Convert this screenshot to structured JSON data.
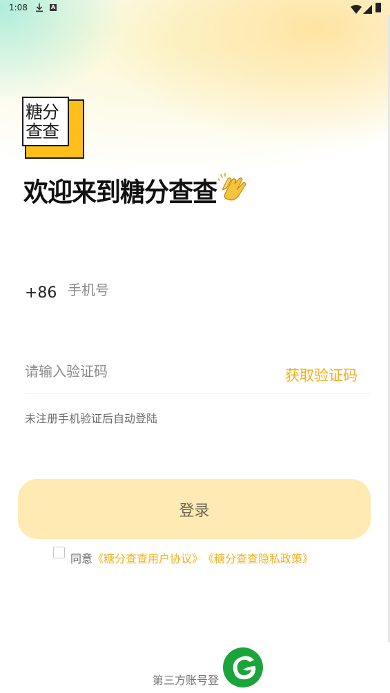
{
  "status_bar": {
    "time": "1:08",
    "icons": [
      "download-icon",
      "accessibility-a-icon",
      "wifi-icon",
      "signal-icon",
      "battery-icon"
    ]
  },
  "logo": {
    "line1": "糖分",
    "line2": "查查",
    "colors": {
      "shadow": "#ffbf1a",
      "face": "#ffffff",
      "outline": "#1a1a1a"
    }
  },
  "welcome": {
    "title": "欢迎来到糖分查查",
    "icon": "clapping-hands-icon"
  },
  "phone": {
    "country_code": "+86",
    "placeholder": "手机号"
  },
  "verification": {
    "placeholder": "请输入验证码",
    "get_code_label": "获取验证码"
  },
  "hint": "未注册手机验证后自动登陆",
  "login_button": "登录",
  "agreement": {
    "prefix": "同意",
    "user_agreement": "《糖分查查用户协议》",
    "privacy_policy": "《糖分查查隐私政策》",
    "checked": false
  },
  "third_party": {
    "label": "第三方账号登",
    "icon": "green-g-leaf-icon"
  },
  "colors": {
    "accent": "#f0b21e",
    "button_bg": "#ffeab4",
    "brand_green": "#1aa53a"
  }
}
